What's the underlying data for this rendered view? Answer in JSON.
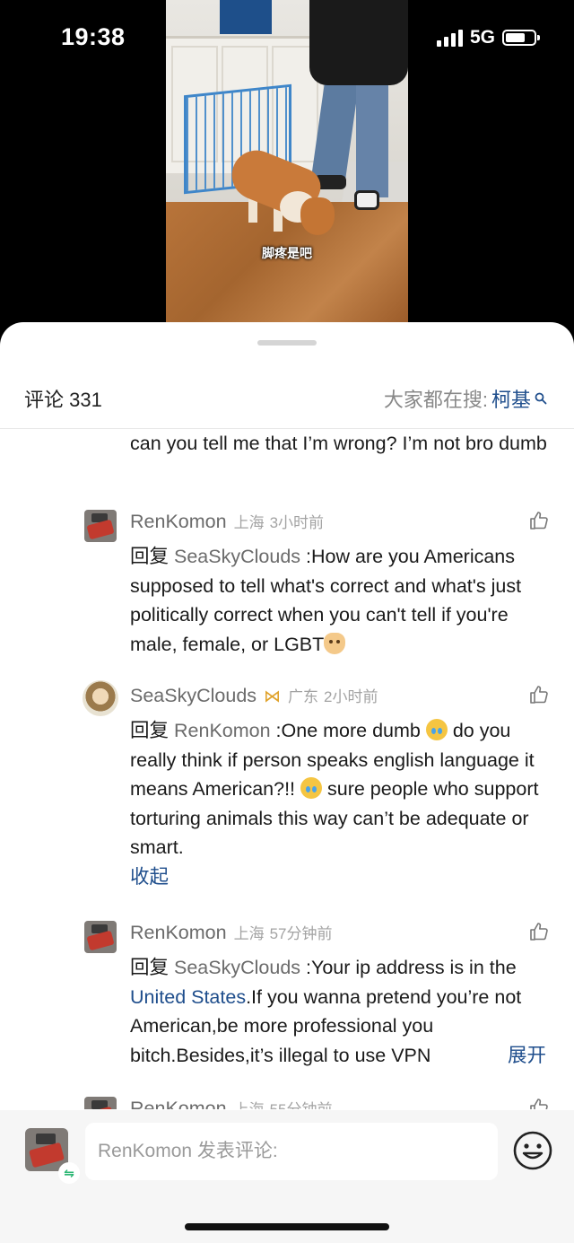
{
  "status_bar": {
    "time": "19:38",
    "network": "5G",
    "battery_level": 0.62
  },
  "video": {
    "subtitle": "脚疼是吧"
  },
  "comments_header": {
    "title": "评论 331",
    "search_prefix": "大家都在搜: ",
    "search_keyword": "柯基",
    "search_icon": "search-icon"
  },
  "comments": {
    "previous_tail": "can you tell me that I’m wrong? I’m not bro dumb",
    "items": [
      {
        "username": "RenKomon",
        "location": "上海",
        "time": "3小时前",
        "reply_prefix": "回复",
        "reply_to": "SeaSkyClouds",
        "text": " :How are you Americans supposed to tell what's correct and what's just politically correct when you can't tell if you're male, female, or LGBT"
      },
      {
        "username": "SeaSkyClouds",
        "badge_icon": "gold-badge-icon",
        "location": "广东",
        "time": "2小时前",
        "reply_prefix": "回复",
        "reply_to": "RenKomon",
        "text_part1": " :One more dumb ",
        "text_part2": "  do you really think if person  speaks  english language   it means American?!! ",
        "text_part3": " sure people who support torturing animals this way can’t be adequate or smart.",
        "collapse_label": "收起"
      },
      {
        "username": "RenKomon",
        "location": "上海",
        "time": "57分钟前",
        "reply_prefix": "回复",
        "reply_to": "SeaSkyClouds",
        "text_part1": " :Your ip address is in the ",
        "ip_link": "United States",
        "text_part2": ".If you wanna pretend you’re not American,be more professional you bitch.Besides,it’s illegal to use VPN",
        "expand_label": "展开"
      },
      {
        "username": "RenKomon",
        "location": "上海",
        "time": "55分钟前"
      }
    ]
  },
  "input_bar": {
    "placeholder": "RenKomon 发表评论:",
    "switch_icon": "switch-account-icon",
    "emoji_icon": "emoji-icon"
  }
}
